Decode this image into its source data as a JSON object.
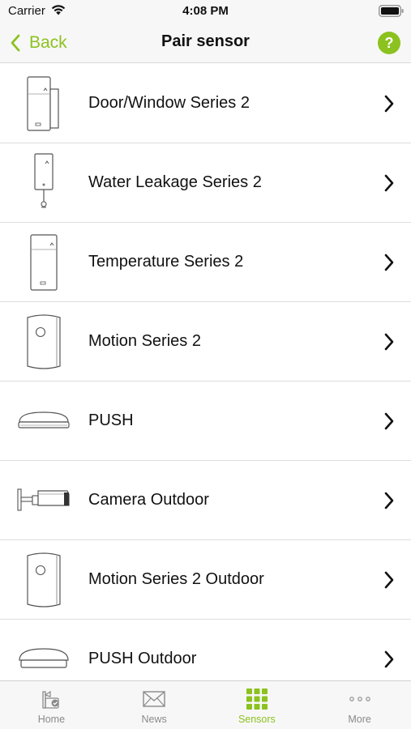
{
  "status_bar": {
    "carrier": "Carrier",
    "time": "4:08 PM"
  },
  "nav": {
    "back_label": "Back",
    "title": "Pair sensor",
    "help_label": "?"
  },
  "colors": {
    "accent": "#8cc21f",
    "tab_inactive": "#8a8a8a",
    "separator": "#dedede"
  },
  "sensors": [
    {
      "label": "Door/Window Series 2",
      "icon": "door-window-sensor-icon"
    },
    {
      "label": "Water Leakage Series 2",
      "icon": "water-leakage-sensor-icon"
    },
    {
      "label": "Temperature Series 2",
      "icon": "temperature-sensor-icon"
    },
    {
      "label": "Motion Series 2",
      "icon": "motion-sensor-icon"
    },
    {
      "label": "PUSH",
      "icon": "push-button-icon"
    },
    {
      "label": "Camera Outdoor",
      "icon": "outdoor-camera-icon"
    },
    {
      "label": "Motion Series 2 Outdoor",
      "icon": "motion-outdoor-sensor-icon"
    },
    {
      "label": "PUSH Outdoor",
      "icon": "push-outdoor-icon"
    }
  ],
  "tabs": [
    {
      "label": "Home",
      "icon": "home-tab-icon",
      "active": false
    },
    {
      "label": "News",
      "icon": "envelope-icon",
      "active": false
    },
    {
      "label": "Sensors",
      "icon": "sensors-grid-icon",
      "active": true
    },
    {
      "label": "More",
      "icon": "more-dots-icon",
      "active": false
    }
  ]
}
